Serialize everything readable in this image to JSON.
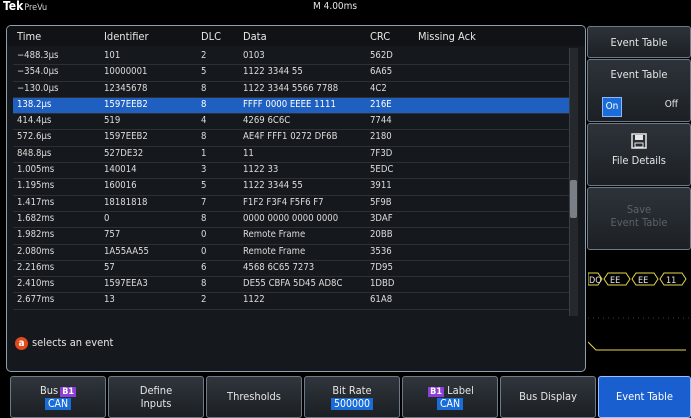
{
  "header": {
    "brand": "Tek",
    "brand_sub": "PreVu",
    "timebase": "M 4.00ms"
  },
  "table": {
    "columns": [
      "Time",
      "Identifier",
      "DLC",
      "Data",
      "CRC",
      "Missing Ack"
    ],
    "selected_index": 3,
    "rows": [
      [
        "−488.3μs",
        "101",
        "2",
        "0103",
        "562D",
        ""
      ],
      [
        "−354.0μs",
        "10000001",
        "5",
        "1122 3344 55",
        "6A65",
        ""
      ],
      [
        "−130.0μs",
        "12345678",
        "8",
        "1122 3344 5566 7788",
        "4C2",
        ""
      ],
      [
        "138.2μs",
        "1597EEB2",
        "8",
        "FFFF 0000 EEEE 1111",
        "216E",
        ""
      ],
      [
        "414.4μs",
        "519",
        "4",
        "4269 6C6C",
        "7744",
        ""
      ],
      [
        "572.6μs",
        "1597EEB2",
        "8",
        "AE4F FFF1 0272 DF6B",
        "2180",
        ""
      ],
      [
        "848.8μs",
        "527DE32",
        "1",
        "11",
        "7F3D",
        ""
      ],
      [
        "1.005ms",
        "140014",
        "3",
        "1122 33",
        "5EDC",
        ""
      ],
      [
        "1.195ms",
        "160016",
        "5",
        "1122 3344 55",
        "3911",
        ""
      ],
      [
        "1.417ms",
        "18181818",
        "7",
        "F1F2 F3F4 F5F6 F7",
        "5F9B",
        ""
      ],
      [
        "1.682ms",
        "0",
        "8",
        "0000 0000 0000 0000",
        "3DAF",
        ""
      ],
      [
        "1.982ms",
        "757",
        "0",
        "Remote Frame",
        "20BB",
        ""
      ],
      [
        "2.080ms",
        "1A55AA55",
        "0",
        "Remote Frame",
        "3536",
        ""
      ],
      [
        "2.216ms",
        "57",
        "6",
        "4568 6C65 7273",
        "7D95",
        ""
      ],
      [
        "2.410ms",
        "1597EEA3",
        "8",
        "DE55 CBFA 5D45 AD8C",
        "1DBD",
        ""
      ],
      [
        "2.677ms",
        "13",
        "2",
        "1122",
        "61A8",
        ""
      ]
    ],
    "hint_badge": "a",
    "hint": "selects an event"
  },
  "side_menu": {
    "title": "Event Table",
    "event_table_label": "Event Table",
    "on": "On",
    "off": "Off",
    "file_details": "File Details",
    "save_label_1": "Save",
    "save_label_2": "Event Table"
  },
  "bottom_menu": {
    "bus_label": "Bus",
    "bus_badge": "B1",
    "bus_value": "CAN",
    "define_1": "Define",
    "define_2": "Inputs",
    "thresholds": "Thresholds",
    "bitrate_label": "Bit Rate",
    "bitrate_value": "500000",
    "label_badge": "B1",
    "label_label": "Label",
    "label_value": "CAN",
    "bus_display": "Bus Display",
    "event_table": "Event Table"
  },
  "waveform": {
    "bus_values": [
      "DO",
      "EE",
      "EE",
      "11"
    ]
  },
  "colors": {
    "selected_row": "#1f5fc0",
    "accent_value": "#5db0ff",
    "bus_badge": "#8f3fd8",
    "hint_badge": "#e04a1c"
  }
}
